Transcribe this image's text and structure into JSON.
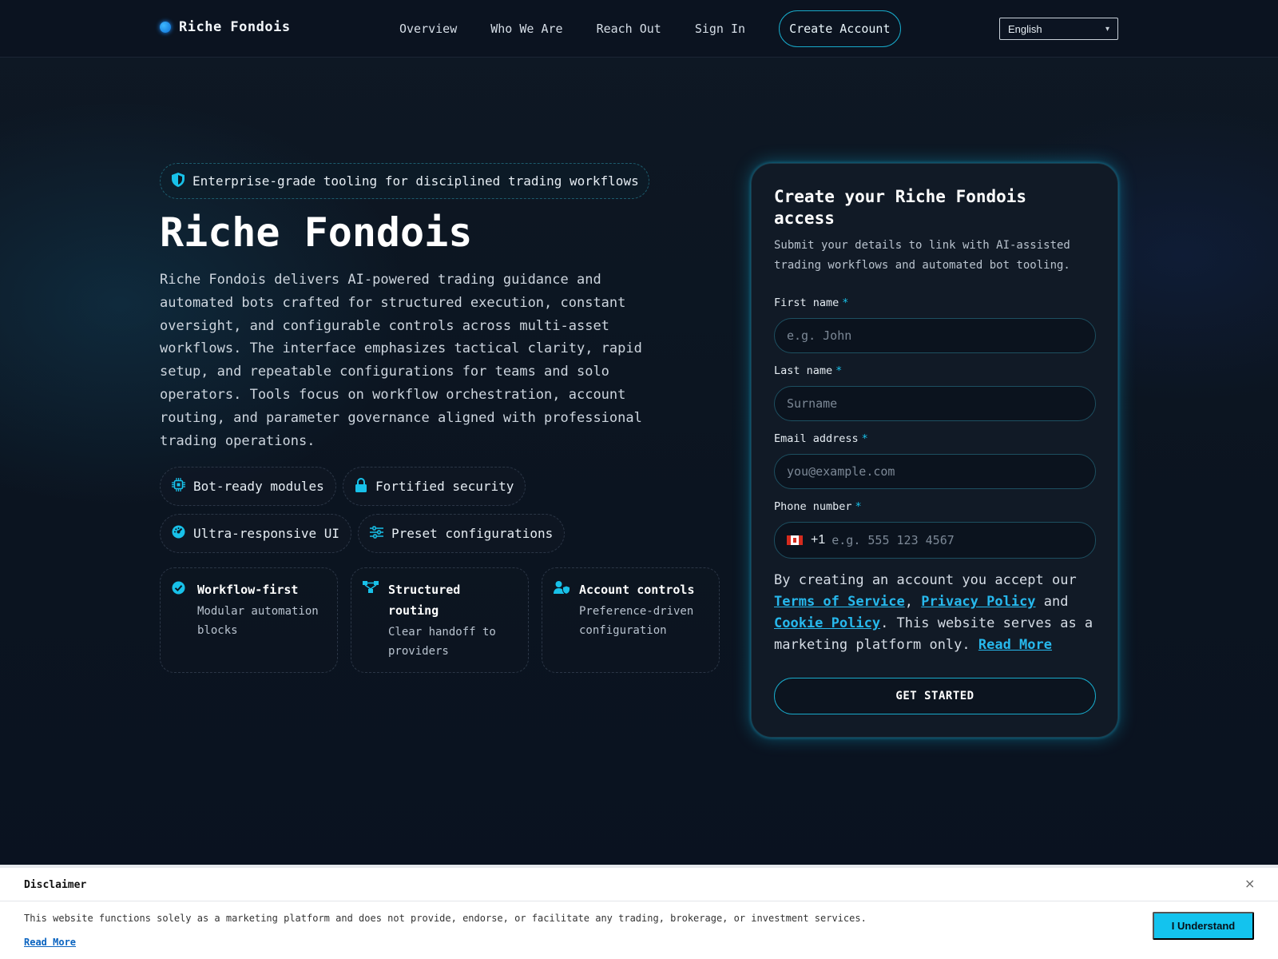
{
  "header": {
    "brand": "Riche Fondois",
    "nav": [
      "Overview",
      "Who We Are",
      "Reach Out",
      "Sign In"
    ],
    "cta": "Create Account",
    "language": "English"
  },
  "hero": {
    "badge": "Enterprise-grade tooling for disciplined trading workflows",
    "title": "Riche Fondois",
    "description": "Riche Fondois delivers AI-powered trading guidance and automated bots crafted for structured execution, constant oversight, and configurable controls across multi-asset workflows. The interface emphasizes tactical clarity, rapid setup, and repeatable configurations for teams and solo operators. Tools focus on workflow orchestration, account routing, and parameter governance aligned with professional trading operations.",
    "chips": [
      {
        "label": "Bot-ready modules",
        "icon": "chip-icon"
      },
      {
        "label": "Fortified security",
        "icon": "lock-icon"
      },
      {
        "label": "Ultra-responsive UI",
        "icon": "speed-icon"
      },
      {
        "label": "Preset configurations",
        "icon": "sliders-icon"
      }
    ],
    "cards": [
      {
        "title": "Workflow-first",
        "desc": "Modular automation blocks",
        "icon": "check-circle-icon"
      },
      {
        "title": "Structured routing",
        "desc": "Clear handoff to providers",
        "icon": "routing-icon"
      },
      {
        "title": "Account controls",
        "desc": "Preference-driven configuration",
        "icon": "user-shield-icon"
      }
    ]
  },
  "form": {
    "title": "Create your Riche Fondois access",
    "subtitle": "Submit your details to link with AI-assisted trading workflows and automated bot tooling.",
    "required_mark": "*",
    "first_name": {
      "label": "First name",
      "placeholder": "e.g. John"
    },
    "last_name": {
      "label": "Last name",
      "placeholder": "Surname"
    },
    "email": {
      "label": "Email address",
      "placeholder": "you@example.com"
    },
    "phone": {
      "label": "Phone number",
      "dial_code": "+1",
      "placeholder": "e.g. 555 123 4567"
    },
    "terms": {
      "prefix": "By creating an account you accept our ",
      "terms_link": "Terms of Service",
      "sep1": ", ",
      "privacy_link": "Privacy Policy",
      "sep2": " and ",
      "cookie_link": "Cookie Policy",
      "suffix": ". This website serves as a marketing platform only. ",
      "read_more": "Read More"
    },
    "submit": "GET STARTED"
  },
  "disclaimer": {
    "title": "Disclaimer",
    "close": "×",
    "text": "This website functions solely as a marketing platform and does not provide, endorse, or facilitate any trading, brokerage, or investment services.",
    "read_more": "Read More",
    "button": "I Understand"
  },
  "colors": {
    "accent": "#18c1e9",
    "background": "#0b1220",
    "card": "#111a26"
  }
}
